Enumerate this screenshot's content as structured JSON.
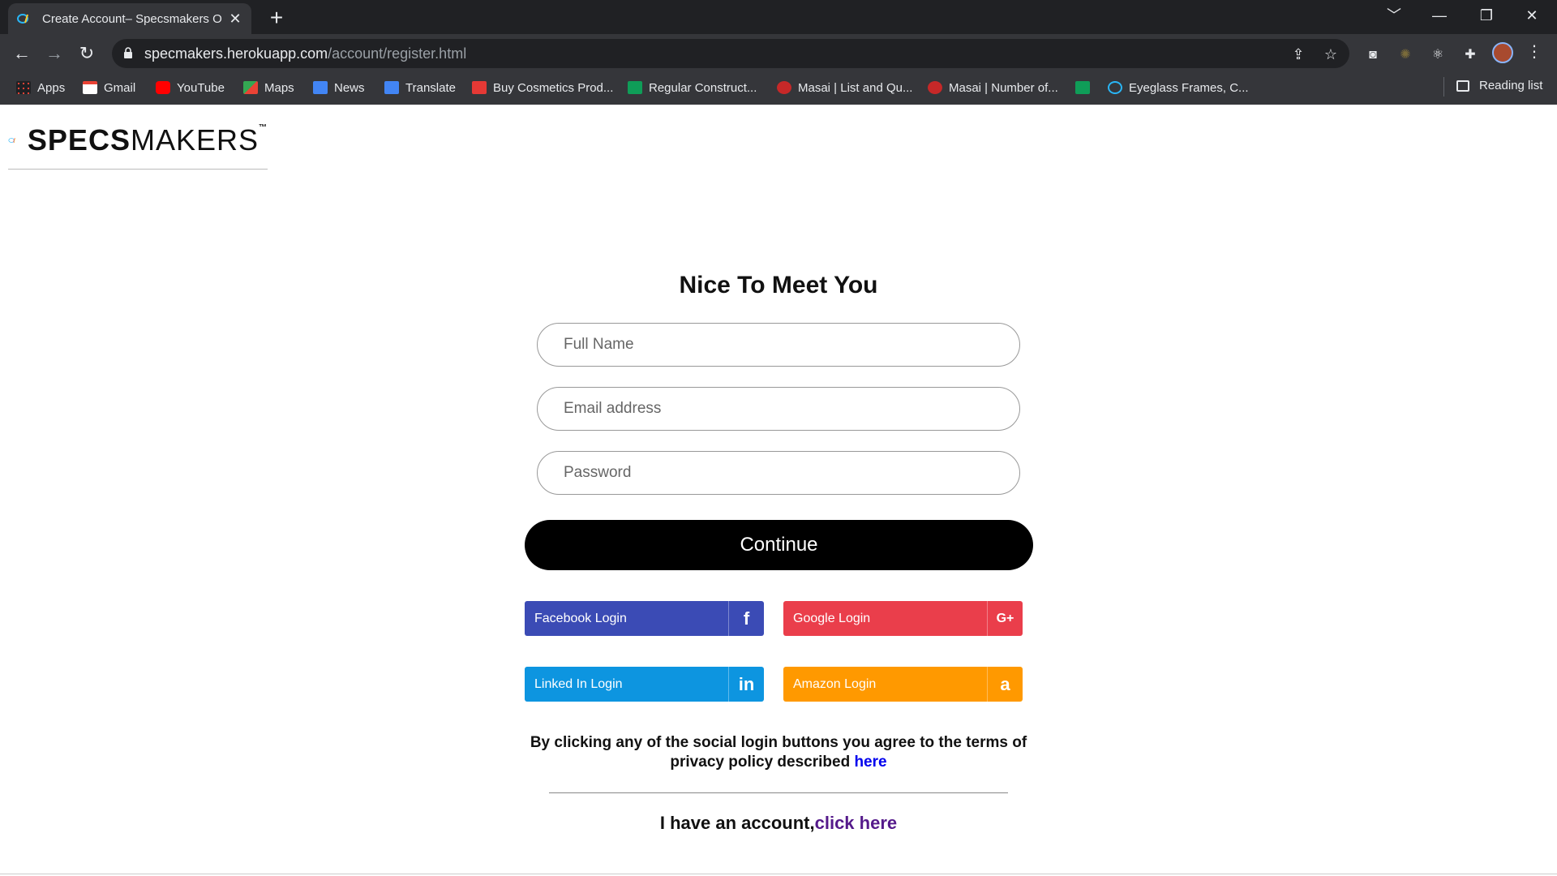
{
  "browser": {
    "tab_title": "Create Account– Specsmakers O",
    "tab_close": "✕",
    "new_tab": "+",
    "url_host": "specmakers.herokuapp.com",
    "url_path": "/account/register.html",
    "window_controls": [
      "﹀",
      "—",
      "❐",
      "✕"
    ],
    "bookmarks": [
      {
        "label": "Apps",
        "icon": "apps-grid-icon",
        "color": "#4285f4"
      },
      {
        "label": "Gmail",
        "icon": "gmail-icon",
        "color": "#ea4335"
      },
      {
        "label": "YouTube",
        "icon": "youtube-icon",
        "color": "#ff0000"
      },
      {
        "label": "Maps",
        "icon": "maps-icon",
        "color": "#34a853"
      },
      {
        "label": "News",
        "icon": "news-icon",
        "color": "#4285f4"
      },
      {
        "label": "Translate",
        "icon": "translate-icon",
        "color": "#4285f4"
      },
      {
        "label": "Buy Cosmetics Prod...",
        "icon": "cosmetics-icon",
        "color": "#e53935"
      },
      {
        "label": "Regular Construct...",
        "icon": "plus-green-icon",
        "color": "#0f9d58"
      },
      {
        "label": "Masai | List and Qu...",
        "icon": "masai-icon",
        "color": "#c62828"
      },
      {
        "label": "Masai | Number of...",
        "icon": "masai-icon",
        "color": "#c62828"
      },
      {
        "label": "",
        "icon": "plus-green-icon",
        "color": "#0f9d58"
      },
      {
        "label": "Eyeglass Frames, C...",
        "icon": "specsmakers-icon",
        "color": "#29b6f6"
      }
    ],
    "reading_list": "Reading list"
  },
  "page": {
    "logo_bold": "SPECS",
    "logo_light": "MAKERS",
    "logo_tm": "™",
    "heading": "Nice To Meet You",
    "fields": {
      "full_name_placeholder": "Full Name",
      "email_placeholder": "Email address",
      "password_placeholder": "Password"
    },
    "continue_label": "Continue",
    "social": {
      "facebook": {
        "label": "Facebook Login",
        "glyph": "f",
        "color": "#3b4bb5"
      },
      "google": {
        "label": "Google Login",
        "glyph": "G+",
        "color": "#ea3e4b"
      },
      "linkedin": {
        "label": "Linked In Login",
        "glyph": "in",
        "color": "#0d95e0"
      },
      "amazon": {
        "label": "Amazon Login",
        "glyph": "a",
        "color": "#ff9900"
      }
    },
    "terms_text": "By clicking any of the social login buttons you agree to the terms of privacy policy described ",
    "terms_link": "here",
    "have_account_text": "I have an account,",
    "have_account_link": "click here"
  }
}
